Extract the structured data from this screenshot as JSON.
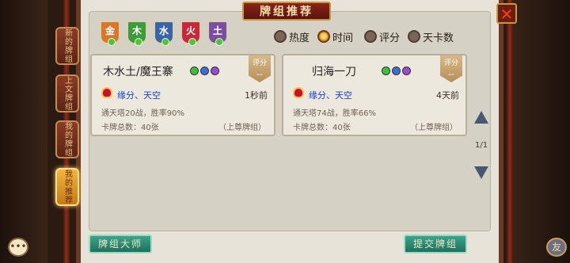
{
  "title": "牌组推荐",
  "close_icon": "✕",
  "side_tabs": [
    {
      "label": "新的牌组",
      "active": false
    },
    {
      "label": "上文牌组",
      "active": false
    },
    {
      "label": "我的牌组",
      "active": false
    },
    {
      "label": "我的推荐",
      "active": true
    }
  ],
  "elements": [
    {
      "label": "金",
      "color": "#d9762a"
    },
    {
      "label": "木",
      "color": "#3d9b3a"
    },
    {
      "label": "水",
      "color": "#3a63a8"
    },
    {
      "label": "火",
      "color": "#c8283c"
    },
    {
      "label": "土",
      "color": "#7a4fa0"
    }
  ],
  "sort_options": [
    {
      "label": "热度",
      "selected": false
    },
    {
      "label": "时间",
      "selected": true
    },
    {
      "label": "评分",
      "selected": false
    },
    {
      "label": "天卡数",
      "selected": false
    }
  ],
  "cards": [
    {
      "name": "木水土/魔王寨",
      "gems": [
        "#3fbf3a",
        "#3a6fd6",
        "#9a4ad0"
      ],
      "score_label": "评分",
      "score_value": "--",
      "author": "缘分、天空",
      "time": "1秒前",
      "stats": "通天塔20战，胜率90%",
      "total": "卡牌总数：40张",
      "upper": "（上尊牌组）"
    },
    {
      "name": "归海一刀",
      "gems": [
        "#3fbf3a",
        "#3a6fd6",
        "#9a4ad0"
      ],
      "score_label": "评分",
      "score_value": "--",
      "author": "缘分、天空",
      "time": "4天前",
      "stats": "通天塔74战，胜率66%",
      "total": "卡牌总数：40张",
      "upper": "（上尊牌组）"
    }
  ],
  "pager": {
    "text": "1/1"
  },
  "buttons": {
    "master": "牌组大师",
    "submit": "提交牌组"
  },
  "chat_icon": "•••",
  "friend_icon": "友"
}
